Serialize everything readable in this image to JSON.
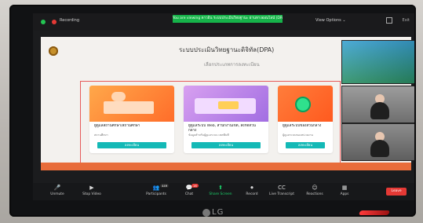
{
  "zoom": {
    "recording_label": "Recording",
    "share_banner": "You are viewing ดาวอิน ระบบประเมินวิทยฐานะ ผ่านทางออนไลน์ (DPA)",
    "view_options": "View Options ⌄",
    "top_right_label": "Exit",
    "toolbar": {
      "unmute": "Unmute",
      "stop_video": "Stop Video",
      "participants": "Participants",
      "participants_count": "449",
      "chat": "Chat",
      "chat_badge": "16",
      "share_screen": "Share Screen",
      "record": "Record",
      "live_transcript": "Live Transcript",
      "reactions": "Reactions",
      "apps": "Apps",
      "end": "Leave"
    }
  },
  "website": {
    "title": "ระบบประเมินวิทยฐานะดิจิทัล(DPA)",
    "subtitle": "เลือกประเภทการลงทะเบียน",
    "cards": [
      {
        "title": "ผู้ดูแลสถานศึกษา/สถานศึกษา",
        "desc": "สถานศึกษา",
        "button": "ลงทะเบียน"
      },
      {
        "title": "ผู้ดูแลระบบ Web, สำนักงานเขต, สังกัดส่วนกลาง",
        "desc": "ข้อมูลสำหรับผู้ดูแลระบบ เขตพื้นที่",
        "button": "ลงทะเบียน"
      },
      {
        "title": "ผู้ดูแลระบบของส่วนกลาง",
        "desc": "ผู้ดูแลระบบของหน่วยงาน",
        "button": "ลงทะเบียน"
      }
    ]
  },
  "monitor": {
    "brand": "LG"
  }
}
